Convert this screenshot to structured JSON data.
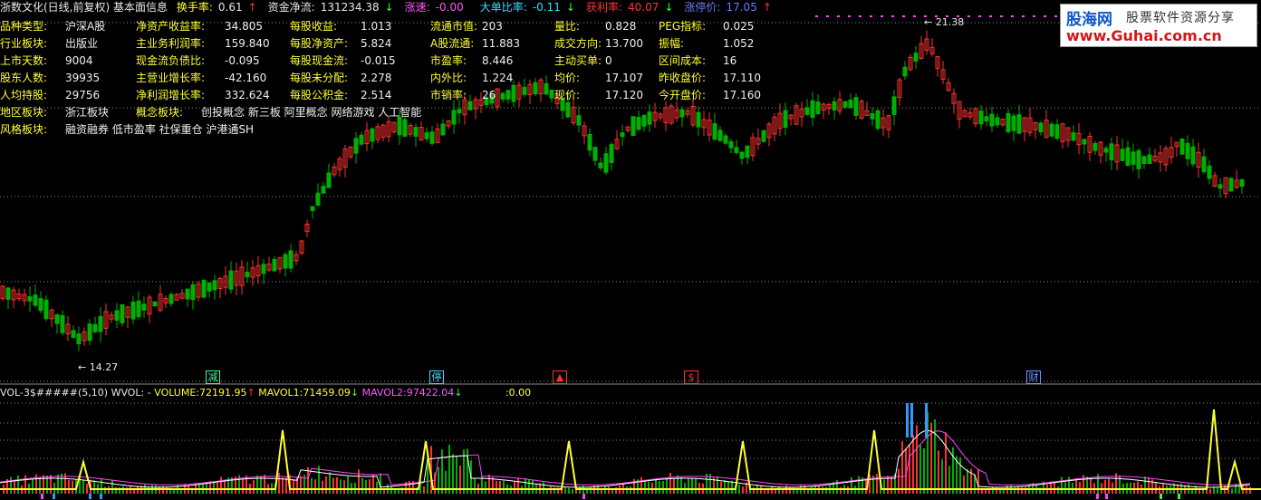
{
  "topbar": {
    "title": "浙数文化(日线,前复权) 基本面信息",
    "items": [
      {
        "label": "换手率:",
        "value": "0.61",
        "arrow": "↑",
        "lc": "y",
        "vc": "w",
        "ac": "r"
      },
      {
        "label": "资金净流:",
        "value": "131234.38",
        "arrow": "↓",
        "lc": "w",
        "vc": "w",
        "ac": "g"
      },
      {
        "label": "涨速:",
        "value": "-0.00",
        "arrow": "",
        "lc": "m",
        "vc": "m",
        "ac": "w"
      },
      {
        "label": "大单比率:",
        "value": "-0.11",
        "arrow": "↓",
        "lc": "c",
        "vc": "c",
        "ac": "g"
      },
      {
        "label": "获利率:",
        "value": "40.07",
        "arrow": "↓",
        "lc": "r",
        "vc": "r",
        "ac": "g"
      },
      {
        "label": "涨停价:",
        "value": "17.05",
        "arrow": "↑",
        "lc": "b",
        "vc": "b",
        "ac": "r"
      }
    ]
  },
  "info": {
    "rows": [
      [
        [
          "品种类型:",
          "沪深A股"
        ],
        [
          "净资产收益率:",
          "34.805"
        ],
        [
          "每股收益:",
          "1.013"
        ],
        [
          "流通市值:",
          "203"
        ],
        [
          "量比:",
          "0.828"
        ],
        [
          "PEG指标:",
          "0.025"
        ]
      ],
      [
        [
          "行业板块:",
          "出版业"
        ],
        [
          "主业务利润率:",
          "159.840"
        ],
        [
          "每股净资产:",
          "5.824"
        ],
        [
          "A股流通:",
          "11.883"
        ],
        [
          "成交方向:",
          "13.700"
        ],
        [
          "振幅:",
          "1.052"
        ]
      ],
      [
        [
          "上市天数:",
          "9004"
        ],
        [
          "现金流负债比:",
          "-0.095"
        ],
        [
          "每股现金流:",
          "-0.015"
        ],
        [
          "市盈率:",
          "8.446"
        ],
        [
          "主动买单:",
          "0"
        ],
        [
          "区间成本:",
          "16"
        ]
      ],
      [
        [
          "股东人数:",
          "39935"
        ],
        [
          "主营业增长率:",
          "-42.160"
        ],
        [
          "每股未分配:",
          "2.278"
        ],
        [
          "内外比:",
          "1.224"
        ],
        [
          "均价:",
          "17.107"
        ],
        [
          "昨收盘价:",
          "17.110"
        ]
      ],
      [
        [
          "人均持股:",
          "29756"
        ],
        [
          "净利润增长率:",
          "332.624"
        ],
        [
          "每股公积金:",
          "2.514"
        ],
        [
          "市销率:",
          "26"
        ],
        [
          "现价:",
          "17.120"
        ],
        [
          "今开盘价:",
          "17.160"
        ]
      ]
    ],
    "region_label": "地区板块:",
    "region_value": "浙江板块",
    "concept_label": "概念板块:",
    "concept_value": "创投概念 新三板 阿里概念 网络游戏 人工智能",
    "style_label": "风格板块:",
    "style_value": "融资融券 低市盈率 社保重仓 沪港通SH"
  },
  "chart_data": {
    "type": "candlestick",
    "price_range": [
      13.8,
      21.8
    ],
    "high_label": "21.38",
    "low_label": "14.27",
    "events": [
      {
        "label": "减",
        "color": "#33ff99"
      },
      {
        "label": "停",
        "color": "#33e0ff"
      },
      {
        "label": "▲",
        "color": "#ff3333"
      },
      {
        "label": "$",
        "color": "#ff3333"
      },
      {
        "label": "财",
        "color": "#6a9bff"
      }
    ]
  },
  "volume": {
    "name": "VOL-3$#####(5,10)",
    "wvol": "WVOL: -",
    "volume_label": "VOLUME:",
    "volume_value": "72191.95",
    "volume_arrow": "↑",
    "mavol1_label": "MAVOL1:",
    "mavol1_value": "71459.09",
    "mavol1_arrow": "↓",
    "mavol2_label": "MAVOL2:",
    "mavol2_value": "97422.04",
    "mavol2_arrow": "↓",
    "extra_label": ":",
    "extra_value": "0.00"
  },
  "logo": {
    "line1": "股海网",
    "line1b": "股票软件资源分享",
    "line2": "www.Guhai.com.cn"
  },
  "colors": {
    "up": "#ff3030",
    "down": "#00b000",
    "grid": "#8a8a8a",
    "signal": "#ffff33",
    "ma1": "#ffffff",
    "ma2": "#ff44ff"
  }
}
